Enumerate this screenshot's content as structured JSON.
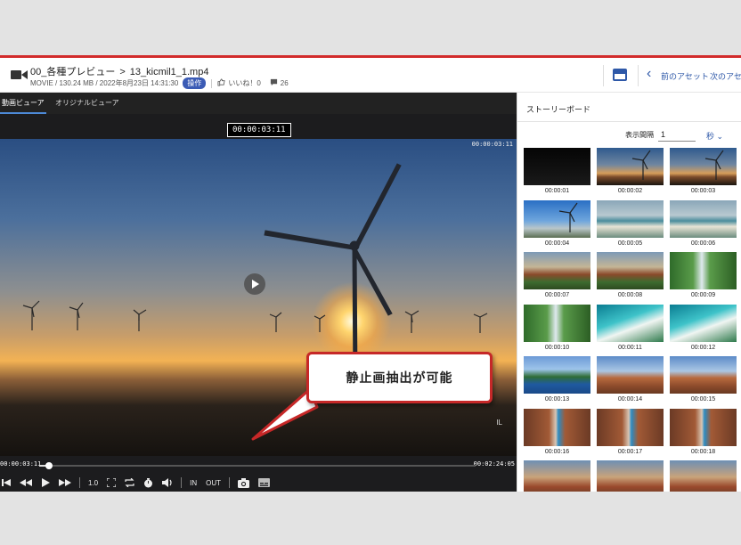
{
  "header": {
    "folder": "00_各種プレビュー",
    "separator": ">",
    "filename": "13_kicmil1_1.mp4",
    "meta": "MOVIE / 130.24 MB / 2022年8月23日 14:31:30",
    "operation_badge": "操作",
    "like_label": "いいね！0",
    "comment_count": "26",
    "prev_asset": "前のアセット",
    "next_asset": "次のアセット",
    "accent_color": "#2e58a8"
  },
  "viewer": {
    "tabs": [
      {
        "label": "動画ビューア",
        "active": true
      },
      {
        "label": "オリジナルビューア",
        "active": false
      }
    ],
    "timecode_top": "00:00:03:11",
    "timecode_overlay": "00:00:03:11",
    "watermark": "IL",
    "current_time": "00:00:03:11",
    "total_time": "00:02:24:05",
    "progress_fraction": 0.023,
    "controls": {
      "speed": "1.0",
      "in_label": "IN",
      "out_label": "OUT"
    }
  },
  "callout": {
    "text": "静止画抽出が可能",
    "border_color": "#c62828"
  },
  "storyboard": {
    "title": "ストーリーボード",
    "interval_label": "表示間隔",
    "interval_value": "1",
    "unit": "秒",
    "thumbnails": [
      {
        "time": "00:00:01",
        "scene": "dark"
      },
      {
        "time": "00:00:02",
        "scene": "turbine"
      },
      {
        "time": "00:00:03",
        "scene": "turbine"
      },
      {
        "time": "00:00:04",
        "scene": "turbine-blue"
      },
      {
        "time": "00:00:05",
        "scene": "coast"
      },
      {
        "time": "00:00:06",
        "scene": "coast"
      },
      {
        "time": "00:00:07",
        "scene": "temple"
      },
      {
        "time": "00:00:08",
        "scene": "temple"
      },
      {
        "time": "00:00:09",
        "scene": "waterfall"
      },
      {
        "time": "00:00:10",
        "scene": "waterfall"
      },
      {
        "time": "00:00:11",
        "scene": "beach"
      },
      {
        "time": "00:00:12",
        "scene": "beach"
      },
      {
        "time": "00:00:13",
        "scene": "island"
      },
      {
        "time": "00:00:14",
        "scene": "town"
      },
      {
        "time": "00:00:15",
        "scene": "town"
      },
      {
        "time": "00:00:16",
        "scene": "avenue"
      },
      {
        "time": "00:00:17",
        "scene": "avenue"
      },
      {
        "time": "00:00:18",
        "scene": "avenue"
      },
      {
        "time": "",
        "scene": "palace"
      },
      {
        "time": "",
        "scene": "palace"
      },
      {
        "time": "",
        "scene": "palace"
      }
    ]
  }
}
